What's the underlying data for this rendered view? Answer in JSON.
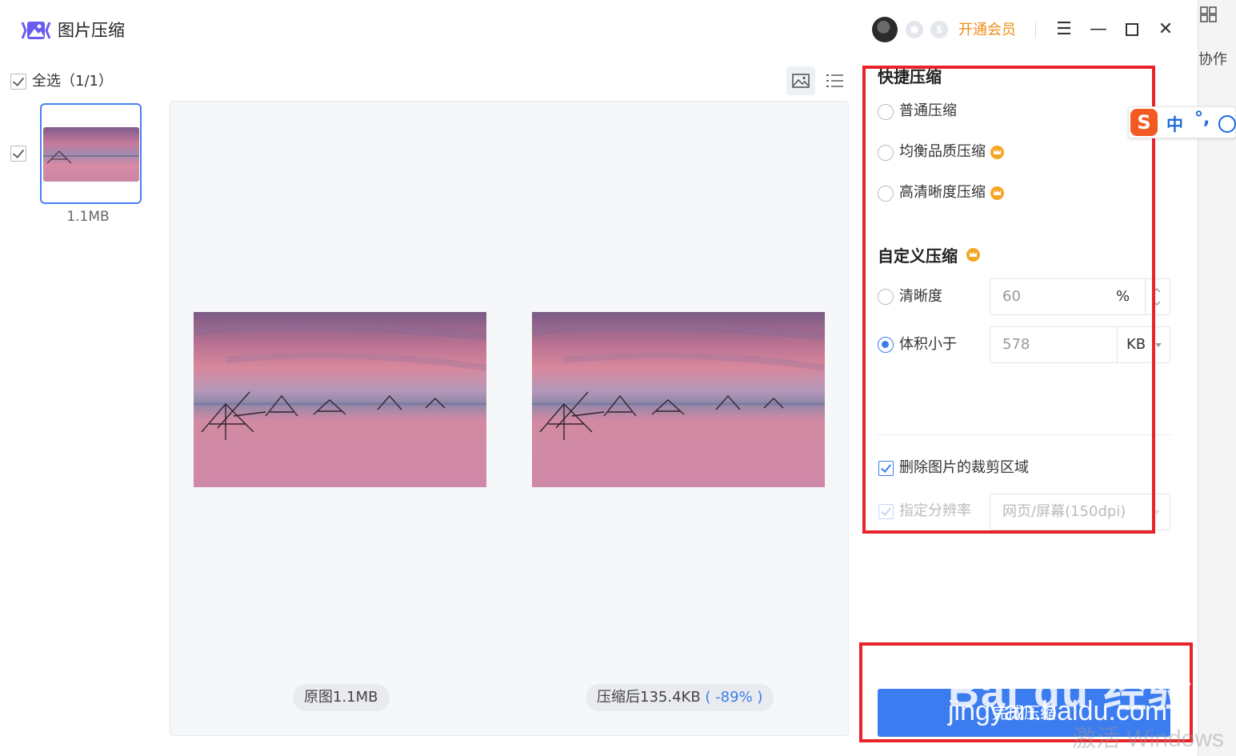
{
  "app": {
    "title": "图片压缩",
    "vip_link": "开通会员"
  },
  "list": {
    "select_all": "全选（1/1）",
    "items": [
      {
        "size": "1.1MB"
      }
    ]
  },
  "preview": {
    "original_label": "原图1.1MB",
    "compressed_label": "压缩后135.4KB",
    "reduction": "( -89% )"
  },
  "quick": {
    "title": "快捷压缩",
    "options": [
      {
        "label": "普通压缩"
      },
      {
        "label": "均衡品质压缩"
      },
      {
        "label": "高清晰度压缩"
      }
    ]
  },
  "custom": {
    "title": "自定义压缩",
    "clarity_label": "清晰度",
    "clarity_value": "60",
    "clarity_unit": "%",
    "size_label": "体积小于",
    "size_value": "578",
    "size_unit": "KB"
  },
  "extra": {
    "remove_crop_label": "删除图片的裁剪区域",
    "resolution_label": "指定分辨率",
    "resolution_value": "网页/屏幕(150dpi)"
  },
  "action": {
    "compress_label": "完成压缩"
  },
  "background_app": {
    "collab": "协作"
  },
  "ime": {
    "logo": "S",
    "mode": "中",
    "punct": "°,"
  },
  "overlay": {
    "watermark_logo": "Bai du 经验",
    "watermark_url": "jingyan.baidu.com",
    "windows_activate": "激活 Windows"
  },
  "colors": {
    "accent": "#3b7cf0",
    "vip": "#f08c16",
    "annotation": "#e8232a"
  }
}
